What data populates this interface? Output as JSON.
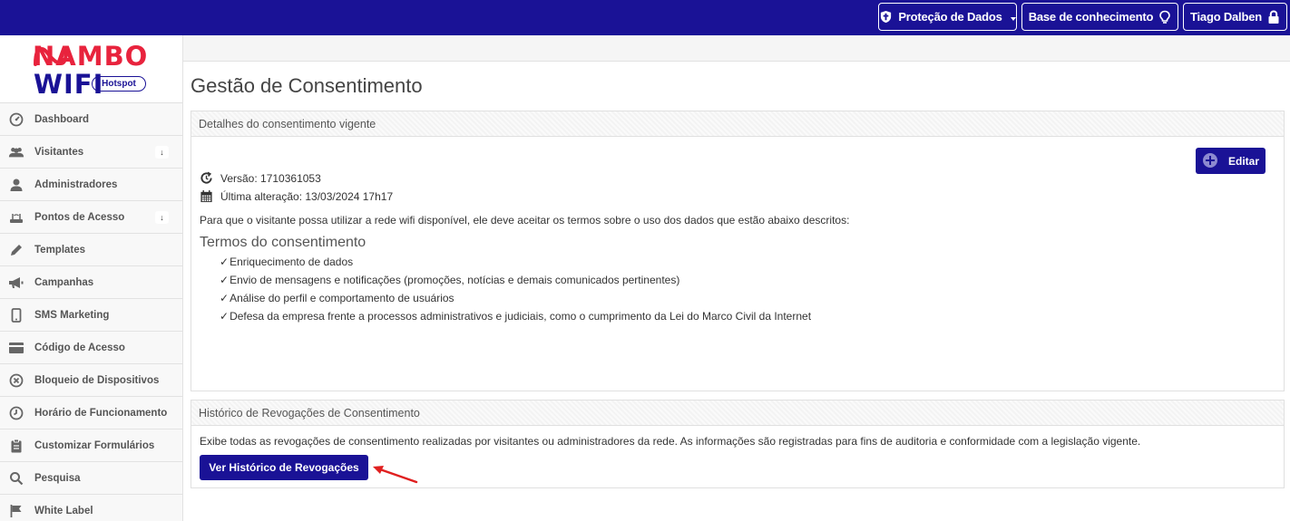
{
  "topbar": {
    "data_protection_label": "Proteção de Dados",
    "knowledge_base_label": "Base de conhecimento",
    "user_name": "Tiago Dalben"
  },
  "logo": {
    "line1": "NAMBO",
    "line2": "WIFI",
    "badge": "Hotspot"
  },
  "sidebar": {
    "items": [
      {
        "label": "Dashboard",
        "icon": "dashboard-gauge-icon"
      },
      {
        "label": "Visitantes",
        "icon": "users-icon",
        "badge": "↓"
      },
      {
        "label": "Administradores",
        "icon": "user-icon"
      },
      {
        "label": "Pontos de Acesso",
        "icon": "router-icon",
        "badge": "↓"
      },
      {
        "label": "Templates",
        "icon": "pencil-icon"
      },
      {
        "label": "Campanhas",
        "icon": "megaphone-icon"
      },
      {
        "label": "SMS Marketing",
        "icon": "mobile-phone-icon"
      },
      {
        "label": "Código de Acesso",
        "icon": "credit-card-icon"
      },
      {
        "label": "Bloqueio de Dispositivos",
        "icon": "block-x-icon"
      },
      {
        "label": "Horário de Funcionamento",
        "icon": "clock-icon"
      },
      {
        "label": "Customizar Formulários",
        "icon": "clipboard-icon"
      },
      {
        "label": "Pesquisa",
        "icon": "search-icon"
      },
      {
        "label": "White Label",
        "icon": "flag-icon"
      }
    ]
  },
  "page": {
    "title": "Gestão de Consentimento"
  },
  "consent_panel": {
    "heading": "Detalhes do consentimento vigente",
    "edit_label": "Editar",
    "version": "Versão: 1710361053",
    "last_change": "Última alteração: 13/03/2024 17h17",
    "description": "Para que o visitante possa utilizar a rede wifi disponível, ele deve aceitar os termos sobre o uso dos dados que estão abaixo descritos:",
    "terms_title": "Termos do consentimento",
    "check_mark": "✓",
    "terms": [
      "Enriquecimento de dados",
      "Envio de mensagens e notificações (promoções, notícias e demais comunicados pertinentes)",
      "Análise do perfil e comportamento de usuários",
      "Defesa da empresa frente a processos administrativos e judiciais, como o cumprimento da Lei do Marco Civil da Internet"
    ]
  },
  "revocation_panel": {
    "heading": "Histórico de Revogações de Consentimento",
    "description": "Exibe todas as revogações de consentimento realizadas por visitantes ou administradores da rede. As informações são registradas para fins de auditoria e conformidade com a legislação vigente.",
    "button_label": "Ver Histórico de Revogações"
  },
  "colors": {
    "brand_blue": "#1a1296",
    "brand_red": "#e8233d",
    "annotation_arrow": "#e02020"
  }
}
